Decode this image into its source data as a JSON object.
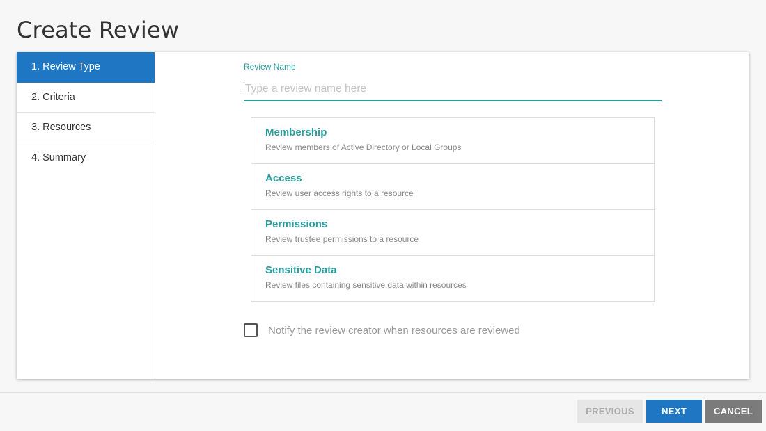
{
  "page": {
    "title": "Create Review"
  },
  "sidebar": {
    "steps": [
      {
        "label": "1. Review Type",
        "active": true
      },
      {
        "label": "2. Criteria",
        "active": false
      },
      {
        "label": "3. Resources",
        "active": false
      },
      {
        "label": "4. Summary",
        "active": false
      }
    ]
  },
  "form": {
    "review_name_label": "Review Name",
    "review_name_value": "",
    "review_name_placeholder": "Type a review name here"
  },
  "review_types": [
    {
      "title": "Membership",
      "description": "Review members of Active Directory or Local Groups"
    },
    {
      "title": "Access",
      "description": "Review user access rights to a resource"
    },
    {
      "title": "Permissions",
      "description": "Review trustee permissions to a resource"
    },
    {
      "title": "Sensitive Data",
      "description": "Review files containing sensitive data within resources"
    }
  ],
  "notify": {
    "label": "Notify the review creator when resources are reviewed",
    "checked": false
  },
  "footer": {
    "previous_label": "PREVIOUS",
    "next_label": "NEXT",
    "cancel_label": "CANCEL"
  },
  "colors": {
    "primary": "#1f77c3",
    "accent": "#2a9d9d",
    "cancel": "#7b7b7b",
    "disabled": "#e6e6e6"
  }
}
